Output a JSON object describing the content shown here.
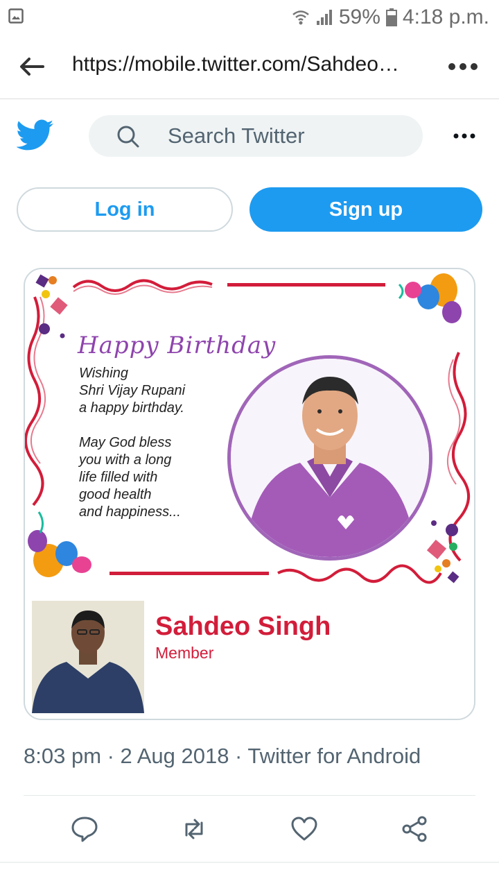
{
  "status_bar": {
    "battery": "59%",
    "time": "4:18 p.m."
  },
  "browser": {
    "url": "https://mobile.twitter.com/Sahdeo…"
  },
  "header": {
    "search_placeholder": "Search Twitter"
  },
  "auth": {
    "login_label": "Log in",
    "signup_label": "Sign up"
  },
  "card": {
    "greeting": "Happy Birthday",
    "message": "Wishing\nShri Vijay Rupani\na happy birthday.\n\nMay God bless\nyou with a long\nlife filled with\ngood health\nand happiness...",
    "member_name": "Sahdeo Singh",
    "member_role": "Member"
  },
  "tweet_meta": {
    "text": "8:03 pm · 2 Aug 2018 · Twitter for Android"
  },
  "actions": {
    "icons": [
      "reply-icon",
      "retweet-icon",
      "like-icon",
      "share-icon"
    ]
  },
  "colors": {
    "twitter_blue": "#1d9bf0",
    "accent_red": "#d21d3a",
    "purple": "#8e44ad"
  }
}
